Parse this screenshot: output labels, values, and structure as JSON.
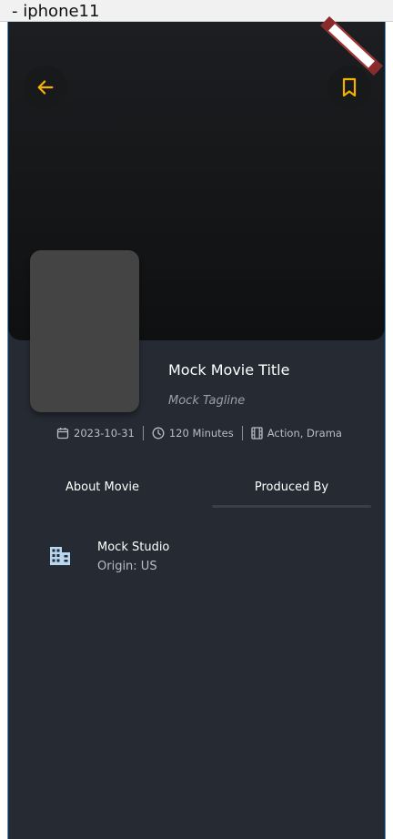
{
  "window": {
    "title": "- iphone11"
  },
  "header": {
    "back_icon": "arrow-left-icon",
    "bookmark_icon": "bookmark-icon",
    "accent_color": "#f5b301"
  },
  "movie": {
    "title": "Mock Movie Title",
    "tagline": "Mock Tagline",
    "release_date": "2023-10-31",
    "runtime": "120 Minutes",
    "genres": "Action, Drama"
  },
  "tabs": [
    {
      "label": "About Movie",
      "active": false
    },
    {
      "label": "Produced By",
      "active": true
    }
  ],
  "production": {
    "companies": [
      {
        "name": "Mock Studio",
        "origin": "Origin: US",
        "icon": "building-icon"
      }
    ]
  },
  "colors": {
    "background": "#252a33",
    "banner": "#111214",
    "poster_placeholder": "#444444",
    "company_icon": "#b7d6ef"
  }
}
